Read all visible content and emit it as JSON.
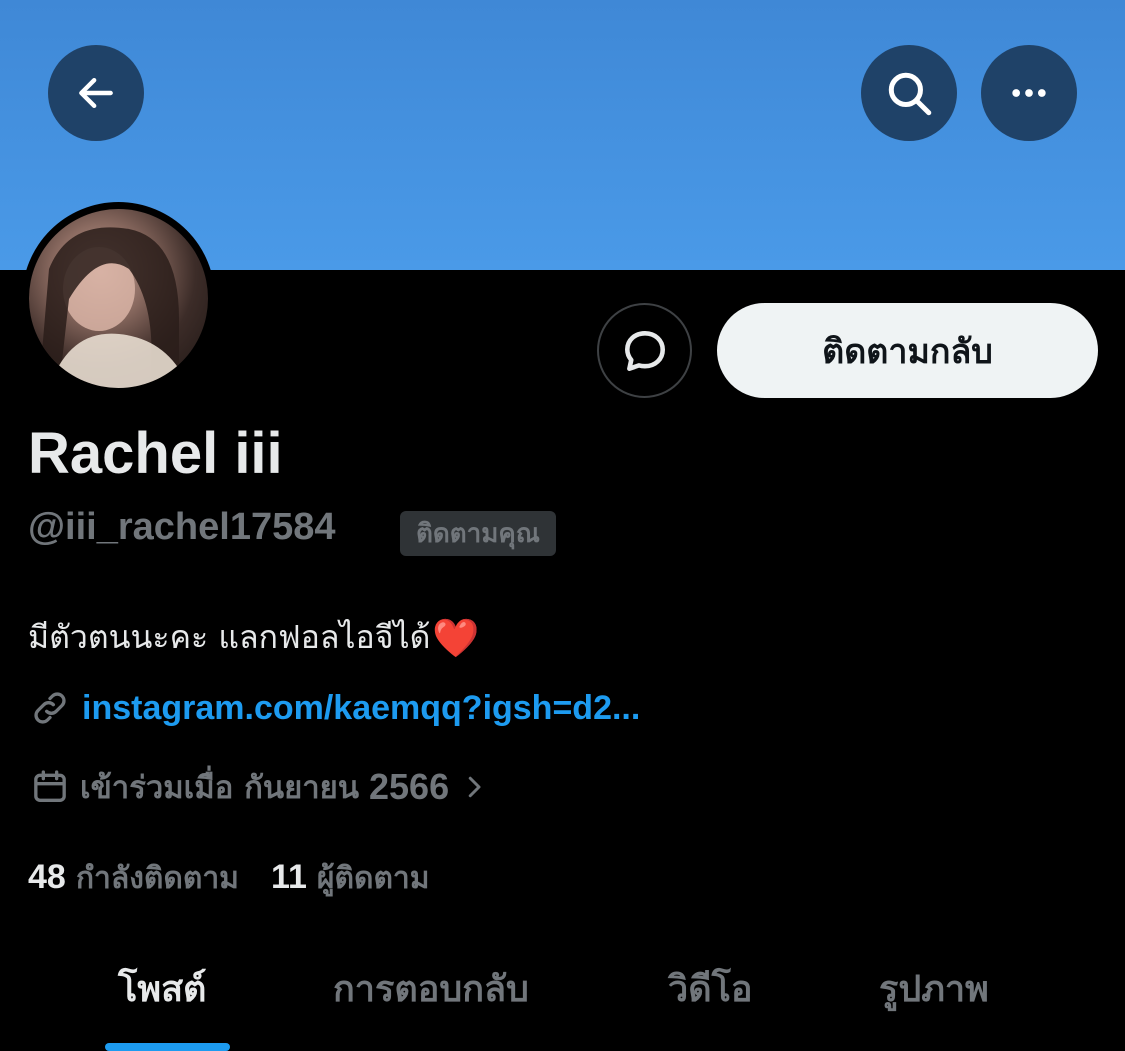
{
  "header": {
    "back_icon": "arrow-left-icon",
    "search_icon": "search-icon",
    "more_icon": "more-horizontal-icon",
    "banner_color": "#4a9ae8"
  },
  "profile": {
    "display_name": "Rachel iii",
    "handle": "@iii_rachel17584",
    "follows_you_badge": "ติดตามคุณ",
    "bio_text": "มีตัวตนนะคะ แลกฟอลไอจีได้",
    "bio_emoji": "❤️",
    "link": "instagram.com/kaemqq?igsh=d2...",
    "joined_label": "เข้าร่วมเมื่อ กันยายน",
    "joined_year": "2566"
  },
  "actions": {
    "message_icon": "message-bubble-icon",
    "follow_back_label": "ติดตามกลับ"
  },
  "stats": {
    "following_count": "48",
    "following_label": "กำลังติดตาม",
    "followers_count": "11",
    "followers_label": "ผู้ติดตาม"
  },
  "tabs": [
    {
      "label": "โพสต์",
      "active": true
    },
    {
      "label": "การตอบกลับ",
      "active": false
    },
    {
      "label": "วิดีโอ",
      "active": false
    },
    {
      "label": "รูปภาพ",
      "active": false
    }
  ],
  "colors": {
    "accent": "#1d9bf0",
    "muted": "#71767b",
    "text": "#e7e9ea",
    "background": "#000000"
  }
}
